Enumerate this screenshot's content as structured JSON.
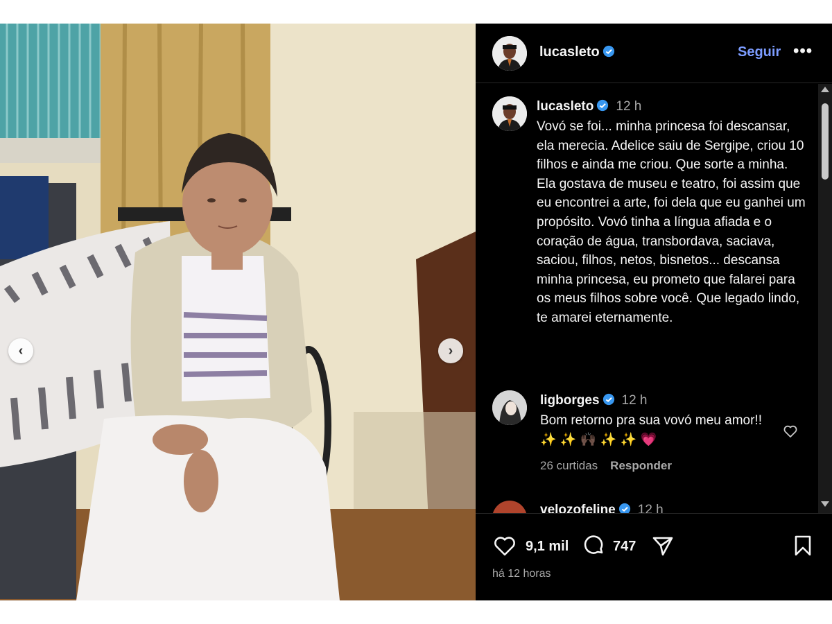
{
  "post": {
    "username": "lucasleto",
    "follow_label": "Seguir",
    "more_label": "•••",
    "caption_time": "12 h",
    "caption": "Vovó se foi... minha princesa foi descansar, ela merecia. Adelice saiu de Sergipe, criou 10 filhos e ainda me criou. Que sorte a minha. Ela gostava de museu e teatro, foi assim que eu encontrei a arte, foi dela que eu ganhei um propósito. Vovó tinha a língua afiada e o coração de água, transbordava, saciava, saciou, filhos, netos, bisnetos... descansa minha princesa, eu prometo que falarei para os meus filhos sobre você. Que legado lindo, te amarei eternamente.",
    "likes": "9,1 mil",
    "comments_count": "747",
    "age": "há 12 horas"
  },
  "comments": [
    {
      "username": "ligborges",
      "time": "12 h",
      "text": "Bom retorno pra sua vovó meu amor!!✨ ✨ 🙌🏿 ✨ ✨ 💗",
      "likes_label": "26 curtidas",
      "reply_label": "Responder"
    },
    {
      "username": "velozofeline",
      "time": "12 h"
    }
  ],
  "colors": {
    "panel_bg": "#000000",
    "follow_blue": "#7c9cff",
    "verified_blue": "#3897f0",
    "muted_text": "#a8a8a8"
  },
  "icons": [
    "chevron-left-icon",
    "chevron-right-icon",
    "verified-icon",
    "more-icon",
    "heart-icon",
    "comment-icon",
    "share-icon",
    "bookmark-icon"
  ]
}
